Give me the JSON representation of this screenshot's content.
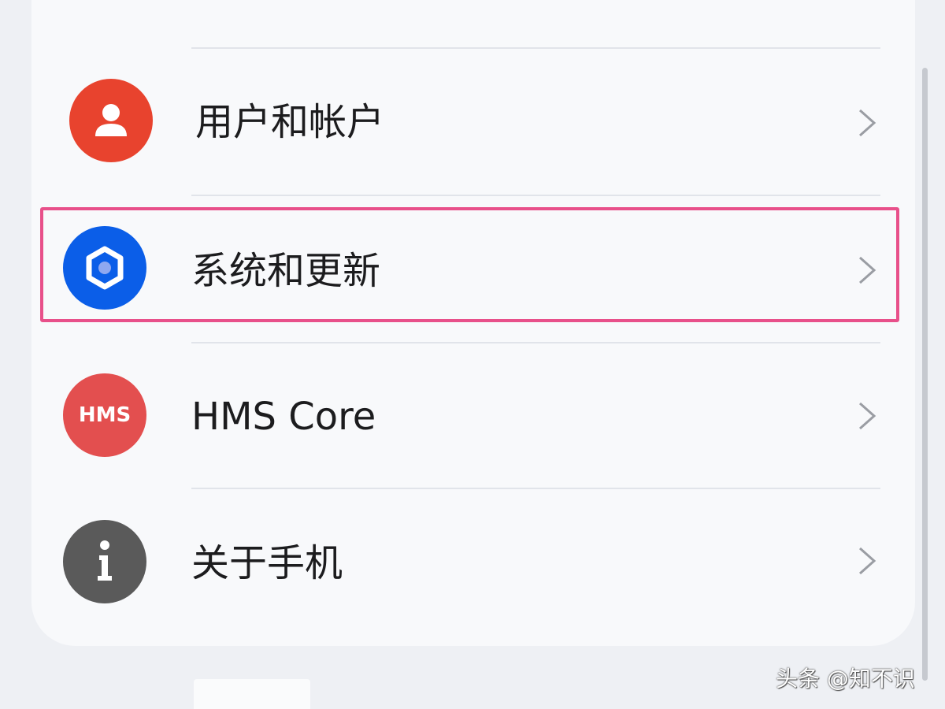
{
  "settings_list": {
    "items": [
      {
        "label": "用户和帐户",
        "icon": "user-icon",
        "icon_color": "#e8432e"
      },
      {
        "label": "系统和更新",
        "icon": "gear-icon",
        "icon_color": "#0b5ee8"
      },
      {
        "label": "HMS Core",
        "icon": "hms-icon",
        "icon_color": "#e34f4f",
        "icon_text": "HMS"
      },
      {
        "label": "关于手机",
        "icon": "info-icon",
        "icon_color": "#5a5a5a"
      }
    ],
    "highlighted_item": "系统和更新",
    "highlight_color": "#e8508a"
  },
  "watermark": {
    "text": "头条 @知不识"
  }
}
